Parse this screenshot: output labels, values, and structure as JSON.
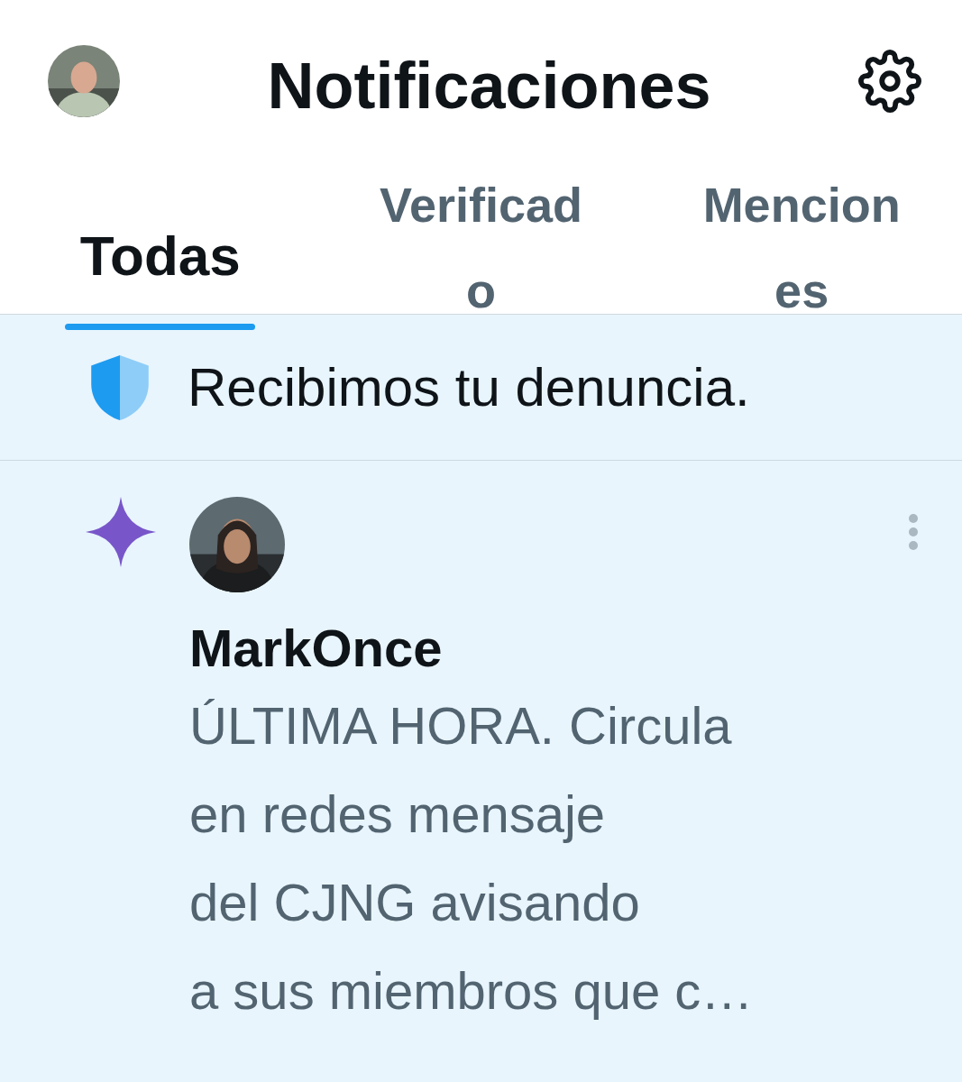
{
  "header": {
    "title": "Notificaciones"
  },
  "tabs": [
    {
      "lines": [
        "Todas"
      ],
      "selected": true
    },
    {
      "lines": [
        "Verificad",
        "o"
      ],
      "selected": false
    },
    {
      "lines": [
        "Mencion",
        "es"
      ],
      "selected": false
    }
  ],
  "notices": [
    {
      "kind": "report",
      "text": "Recibimos tu denuncia."
    },
    {
      "kind": "post",
      "author": "MarkOnce",
      "text": "ÚLTIMA HORA. Circula\nen redes mensaje\ndel CJNG avisando\na sus miembros que c…"
    }
  ]
}
